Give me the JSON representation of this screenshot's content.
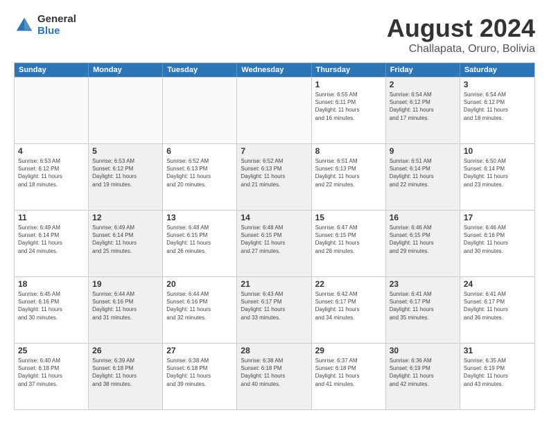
{
  "logo": {
    "line1": "General",
    "line2": "Blue"
  },
  "title": "August 2024",
  "subtitle": "Challapata, Oruro, Bolivia",
  "header_days": [
    "Sunday",
    "Monday",
    "Tuesday",
    "Wednesday",
    "Thursday",
    "Friday",
    "Saturday"
  ],
  "weeks": [
    [
      {
        "day": "",
        "info": "",
        "shaded": false,
        "empty": true
      },
      {
        "day": "",
        "info": "",
        "shaded": false,
        "empty": true
      },
      {
        "day": "",
        "info": "",
        "shaded": false,
        "empty": true
      },
      {
        "day": "",
        "info": "",
        "shaded": false,
        "empty": true
      },
      {
        "day": "1",
        "info": "Sunrise: 6:55 AM\nSunset: 6:11 PM\nDaylight: 11 hours\nand 16 minutes.",
        "shaded": false,
        "empty": false
      },
      {
        "day": "2",
        "info": "Sunrise: 6:54 AM\nSunset: 6:12 PM\nDaylight: 11 hours\nand 17 minutes.",
        "shaded": true,
        "empty": false
      },
      {
        "day": "3",
        "info": "Sunrise: 6:54 AM\nSunset: 6:12 PM\nDaylight: 11 hours\nand 18 minutes.",
        "shaded": false,
        "empty": false
      }
    ],
    [
      {
        "day": "4",
        "info": "Sunrise: 6:53 AM\nSunset: 6:12 PM\nDaylight: 11 hours\nand 18 minutes.",
        "shaded": false,
        "empty": false
      },
      {
        "day": "5",
        "info": "Sunrise: 6:53 AM\nSunset: 6:12 PM\nDaylight: 11 hours\nand 19 minutes.",
        "shaded": true,
        "empty": false
      },
      {
        "day": "6",
        "info": "Sunrise: 6:52 AM\nSunset: 6:13 PM\nDaylight: 11 hours\nand 20 minutes.",
        "shaded": false,
        "empty": false
      },
      {
        "day": "7",
        "info": "Sunrise: 6:52 AM\nSunset: 6:13 PM\nDaylight: 11 hours\nand 21 minutes.",
        "shaded": true,
        "empty": false
      },
      {
        "day": "8",
        "info": "Sunrise: 6:51 AM\nSunset: 6:13 PM\nDaylight: 11 hours\nand 22 minutes.",
        "shaded": false,
        "empty": false
      },
      {
        "day": "9",
        "info": "Sunrise: 6:51 AM\nSunset: 6:14 PM\nDaylight: 11 hours\nand 22 minutes.",
        "shaded": true,
        "empty": false
      },
      {
        "day": "10",
        "info": "Sunrise: 6:50 AM\nSunset: 6:14 PM\nDaylight: 11 hours\nand 23 minutes.",
        "shaded": false,
        "empty": false
      }
    ],
    [
      {
        "day": "11",
        "info": "Sunrise: 6:49 AM\nSunset: 6:14 PM\nDaylight: 11 hours\nand 24 minutes.",
        "shaded": false,
        "empty": false
      },
      {
        "day": "12",
        "info": "Sunrise: 6:49 AM\nSunset: 6:14 PM\nDaylight: 11 hours\nand 25 minutes.",
        "shaded": true,
        "empty": false
      },
      {
        "day": "13",
        "info": "Sunrise: 6:48 AM\nSunset: 6:15 PM\nDaylight: 11 hours\nand 26 minutes.",
        "shaded": false,
        "empty": false
      },
      {
        "day": "14",
        "info": "Sunrise: 6:48 AM\nSunset: 6:15 PM\nDaylight: 11 hours\nand 27 minutes.",
        "shaded": true,
        "empty": false
      },
      {
        "day": "15",
        "info": "Sunrise: 6:47 AM\nSunset: 6:15 PM\nDaylight: 11 hours\nand 28 minutes.",
        "shaded": false,
        "empty": false
      },
      {
        "day": "16",
        "info": "Sunrise: 6:46 AM\nSunset: 6:15 PM\nDaylight: 11 hours\nand 29 minutes.",
        "shaded": true,
        "empty": false
      },
      {
        "day": "17",
        "info": "Sunrise: 6:46 AM\nSunset: 6:16 PM\nDaylight: 11 hours\nand 30 minutes.",
        "shaded": false,
        "empty": false
      }
    ],
    [
      {
        "day": "18",
        "info": "Sunrise: 6:45 AM\nSunset: 6:16 PM\nDaylight: 11 hours\nand 30 minutes.",
        "shaded": false,
        "empty": false
      },
      {
        "day": "19",
        "info": "Sunrise: 6:44 AM\nSunset: 6:16 PM\nDaylight: 11 hours\nand 31 minutes.",
        "shaded": true,
        "empty": false
      },
      {
        "day": "20",
        "info": "Sunrise: 6:44 AM\nSunset: 6:16 PM\nDaylight: 11 hours\nand 32 minutes.",
        "shaded": false,
        "empty": false
      },
      {
        "day": "21",
        "info": "Sunrise: 6:43 AM\nSunset: 6:17 PM\nDaylight: 11 hours\nand 33 minutes.",
        "shaded": true,
        "empty": false
      },
      {
        "day": "22",
        "info": "Sunrise: 6:42 AM\nSunset: 6:17 PM\nDaylight: 11 hours\nand 34 minutes.",
        "shaded": false,
        "empty": false
      },
      {
        "day": "23",
        "info": "Sunrise: 6:41 AM\nSunset: 6:17 PM\nDaylight: 11 hours\nand 35 minutes.",
        "shaded": true,
        "empty": false
      },
      {
        "day": "24",
        "info": "Sunrise: 6:41 AM\nSunset: 6:17 PM\nDaylight: 11 hours\nand 36 minutes.",
        "shaded": false,
        "empty": false
      }
    ],
    [
      {
        "day": "25",
        "info": "Sunrise: 6:40 AM\nSunset: 6:18 PM\nDaylight: 11 hours\nand 37 minutes.",
        "shaded": false,
        "empty": false
      },
      {
        "day": "26",
        "info": "Sunrise: 6:39 AM\nSunset: 6:18 PM\nDaylight: 11 hours\nand 38 minutes.",
        "shaded": true,
        "empty": false
      },
      {
        "day": "27",
        "info": "Sunrise: 6:38 AM\nSunset: 6:18 PM\nDaylight: 11 hours\nand 39 minutes.",
        "shaded": false,
        "empty": false
      },
      {
        "day": "28",
        "info": "Sunrise: 6:38 AM\nSunset: 6:18 PM\nDaylight: 11 hours\nand 40 minutes.",
        "shaded": true,
        "empty": false
      },
      {
        "day": "29",
        "info": "Sunrise: 6:37 AM\nSunset: 6:18 PM\nDaylight: 11 hours\nand 41 minutes.",
        "shaded": false,
        "empty": false
      },
      {
        "day": "30",
        "info": "Sunrise: 6:36 AM\nSunset: 6:19 PM\nDaylight: 11 hours\nand 42 minutes.",
        "shaded": true,
        "empty": false
      },
      {
        "day": "31",
        "info": "Sunrise: 6:35 AM\nSunset: 6:19 PM\nDaylight: 11 hours\nand 43 minutes.",
        "shaded": false,
        "empty": false
      }
    ]
  ]
}
